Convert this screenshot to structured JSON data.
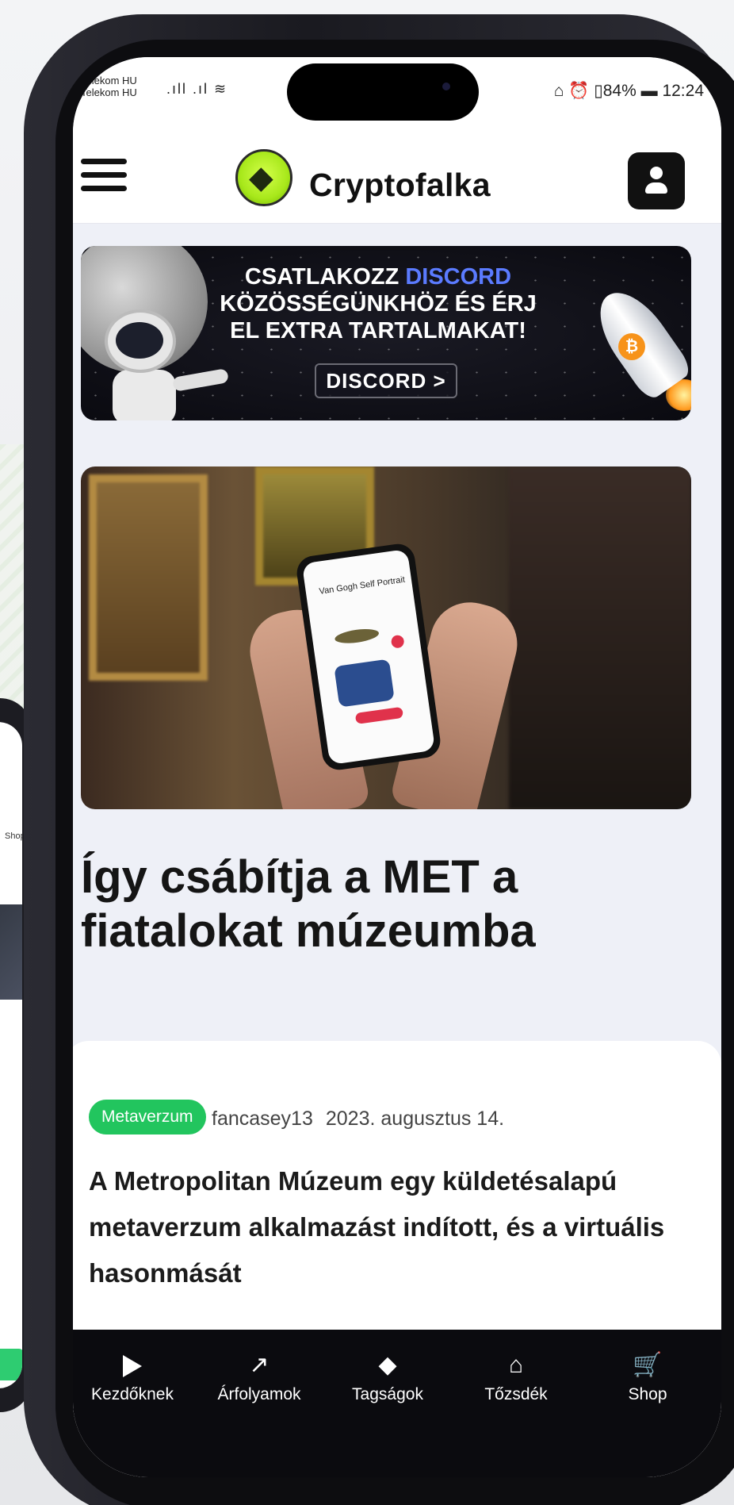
{
  "status_bar": {
    "carrier_1": "Telekom HU",
    "carrier_2": "Telekom HU",
    "right": "⌂ ⏰ ▯84% ▬ 12:24"
  },
  "header": {
    "brand": "Cryptofalka"
  },
  "banner": {
    "line1_prefix": "CSATLAKOZZ ",
    "line1_accent": "DISCORD",
    "line2": "KÖZÖSSÉGÜNKHÖZ ÉS ÉRJ",
    "line3": "EL EXTRA TARTALMAKAT!",
    "button": "DISCORD >",
    "accent_color": "#5b7bff"
  },
  "hero_image": {
    "phone_screen_text": "Van Gogh Self Portrait"
  },
  "article": {
    "title": "Így csábítja a MET a fiatalokat múzeumba",
    "category": "Metaverzum",
    "author": "fancasey13",
    "date": "2023. augusztus 14.",
    "excerpt": "A Metropolitan Múzeum egy küldetésalapú metaverzum alkalmazást indított, és a virtuális hasonmását"
  },
  "tabbar": {
    "items": [
      {
        "label": "Kezdőknek",
        "icon": "play-icon"
      },
      {
        "label": "Árfolyamok",
        "icon": "trend-up-icon"
      },
      {
        "label": "Tagságok",
        "icon": "diamond-icon"
      },
      {
        "label": "Tőzsdék",
        "icon": "bank-icon"
      },
      {
        "label": "Shop",
        "icon": "cart-icon"
      }
    ]
  },
  "background_phone": {
    "shop_label": "Shop"
  },
  "colors": {
    "category_green": "#22c55e",
    "tabbar_bg": "#0b0b0f"
  }
}
